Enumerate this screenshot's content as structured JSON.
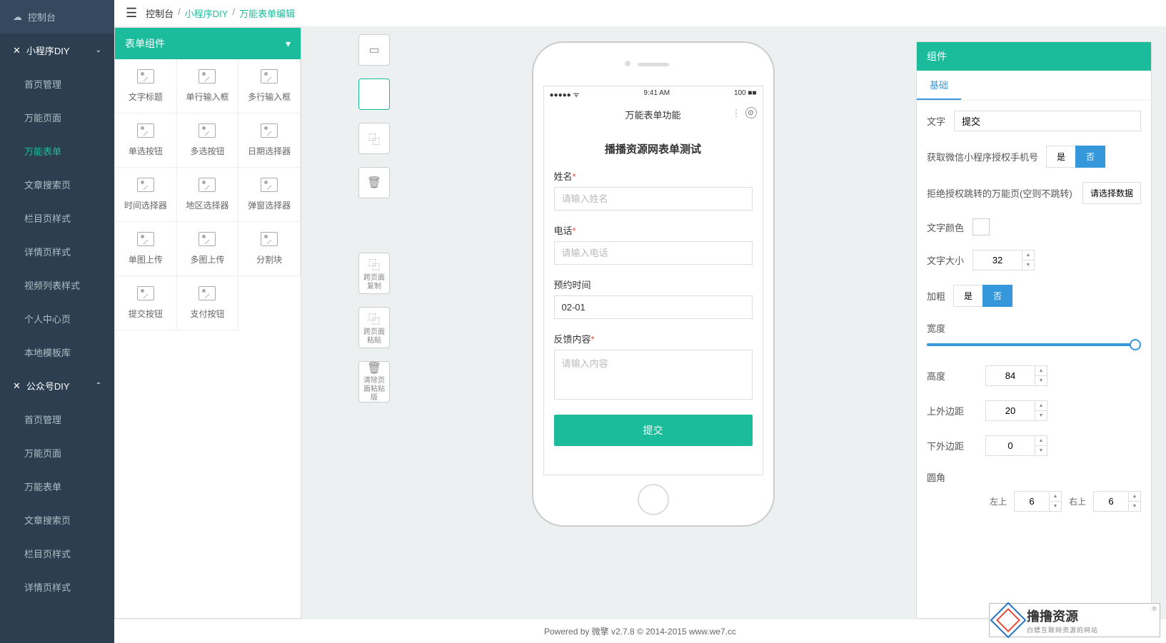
{
  "sidebar": {
    "console": "控制台",
    "groups": [
      {
        "title": "小程序DIY",
        "items": [
          "首页管理",
          "万能页面",
          "万能表单",
          "文章搜索页",
          "栏目页样式",
          "详情页样式",
          "视频列表样式",
          "个人中心页",
          "本地模板库"
        ],
        "active": 2
      },
      {
        "title": "公众号DIY",
        "items": [
          "首页管理",
          "万能页面",
          "万能表单",
          "文章搜索页",
          "栏目页样式",
          "详情页样式"
        ]
      }
    ]
  },
  "breadcrumb": [
    "控制台",
    "小程序DIY",
    "万能表单编辑"
  ],
  "components": {
    "header": "表单组件",
    "items": [
      "文字标题",
      "单行输入框",
      "多行输入框",
      "单选按钮",
      "多选按钮",
      "日期选择器",
      "时间选择器",
      "地区选择器",
      "弹窗选择器",
      "单图上传",
      "多图上传",
      "分割块",
      "提交按钮",
      "支付按钮"
    ]
  },
  "tools": [
    {
      "icon": "▭",
      "label": ""
    },
    {
      "icon": "",
      "label": ""
    },
    {
      "icon": "⿻",
      "label": ""
    },
    {
      "icon": "🗑",
      "label": ""
    },
    {
      "icon": "⿻",
      "label": "跨页面复制"
    },
    {
      "icon": "⿻",
      "label": "跨页面粘贴"
    },
    {
      "icon": "🗑",
      "label": "清除页面粘贴版"
    }
  ],
  "phone": {
    "time": "9:41 AM",
    "battery": "100",
    "signal": "●●●●●  ᯤ",
    "title": "万能表单功能",
    "formTitle": "播播资源网表单测试",
    "fields": [
      {
        "label": "姓名",
        "required": true,
        "placeholder": "请输入姓名",
        "type": "text"
      },
      {
        "label": "电话",
        "required": true,
        "placeholder": "请输入电话",
        "type": "text"
      },
      {
        "label": "预约时间",
        "required": false,
        "value": "02-01",
        "type": "text"
      },
      {
        "label": "反馈内容",
        "required": true,
        "placeholder": "请输入内容",
        "type": "textarea"
      }
    ],
    "submit": "提交"
  },
  "props": {
    "header": "组件",
    "tab": "基础",
    "text_label": "文字",
    "text_value": "提交",
    "wechat_phone_label": "获取微信小程序授权手机号",
    "yes": "是",
    "no": "否",
    "reject_label": "拒绝授权跳转的万能页(空则不跳转)",
    "select_data": "请选择数据",
    "color_label": "文字颜色",
    "fontsize_label": "文字大小",
    "fontsize_value": "32",
    "bold_label": "加粗",
    "width_label": "宽度",
    "height_label": "高度",
    "height_value": "84",
    "mt_label": "上外边距",
    "mt_value": "20",
    "mb_label": "下外边距",
    "mb_value": "0",
    "radius_label": "圆角",
    "tl_label": "左上",
    "tl_value": "6",
    "tr_label": "右上",
    "tr_value": "6"
  },
  "footer": "Powered by 微擎 v2.7.8 © 2014-2015 www.we7.cc",
  "logo": {
    "big": "撸撸资源",
    "small": "白嫖互联网资源的网站"
  }
}
